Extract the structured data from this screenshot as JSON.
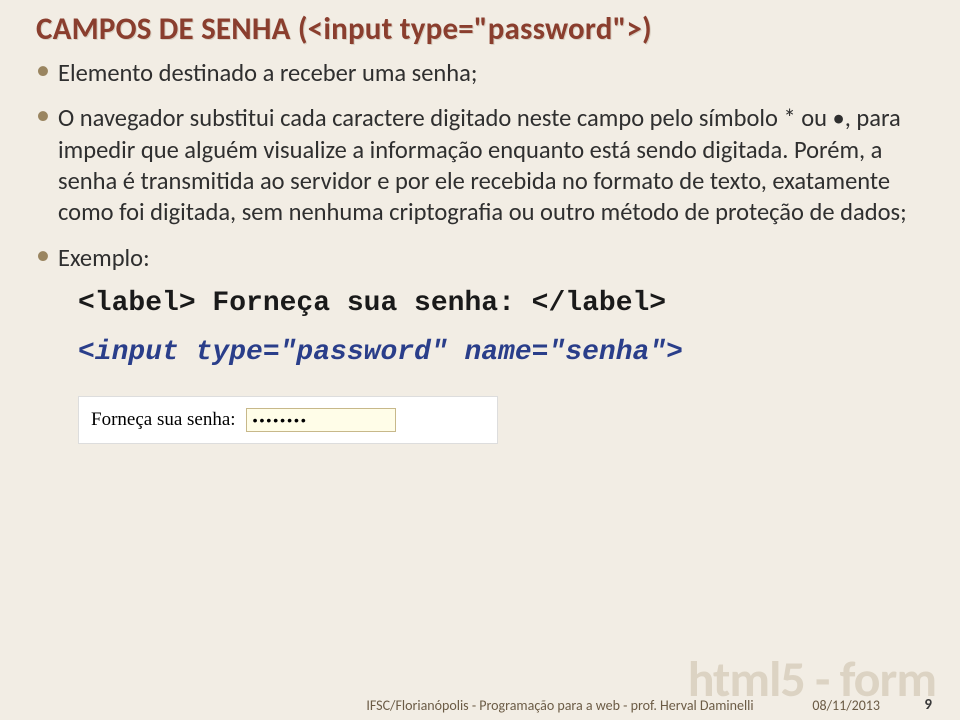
{
  "title": "CAMPOS DE SENHA (<input type=\"password\">)",
  "bullets": {
    "b0": "Elemento destinado a receber uma senha;",
    "b1": "O navegador substitui cada caractere digitado neste campo pelo símbolo * ou •, para impedir que alguém visualize a informação enquanto está sendo digitada. Porém, a senha é transmitida ao servidor e por ele recebida no formato de texto, exatamente como foi digitada, sem nenhuma criptografia ou outro método de proteção de dados;",
    "b2": "Exemplo:"
  },
  "code": {
    "line1": "<label> Forneça sua senha: </label>",
    "line2": "<input type=\"password\" name=\"senha\">"
  },
  "example": {
    "label": "Forneça sua senha:",
    "value": "••••••••"
  },
  "watermark": "html5 - form",
  "footer": {
    "left": "IFSC/Florianópolis - Programação para a web - prof. Herval Daminelli",
    "date": "08/11/2013",
    "page": "9"
  }
}
